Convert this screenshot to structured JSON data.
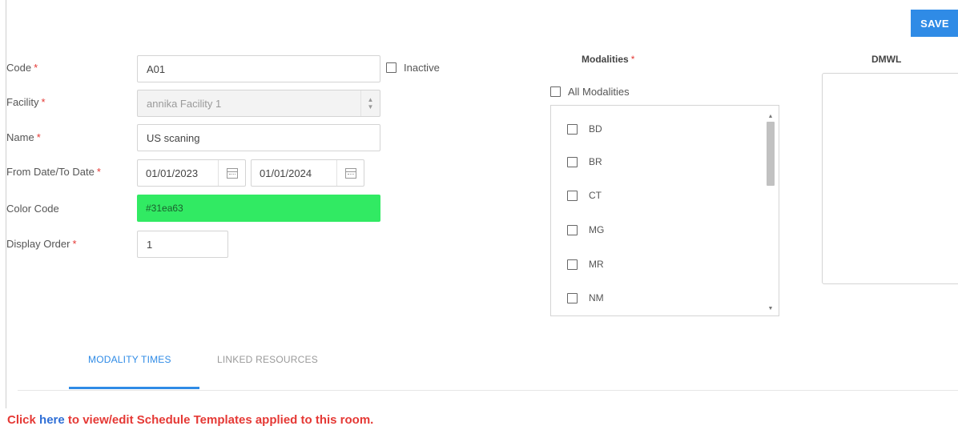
{
  "toolbar": {
    "save_label": "SAVE"
  },
  "form": {
    "code": {
      "label": "Code",
      "value": "A01"
    },
    "inactive_label": "Inactive",
    "facility": {
      "label": "Facility",
      "value": "annika Facility 1"
    },
    "name": {
      "label": "Name",
      "value": "US scaning"
    },
    "dates": {
      "label": "From Date/To Date",
      "from": "01/01/2023",
      "to": "01/01/2024"
    },
    "color_code": {
      "label": "Color Code",
      "value": "#31ea63"
    },
    "display_order": {
      "label": "Display Order",
      "value": "1"
    },
    "required_marker": "*"
  },
  "modalities": {
    "title": "Modalities",
    "all_label": "All Modalities",
    "items": [
      "BD",
      "BR",
      "CT",
      "MG",
      "MR",
      "NM"
    ]
  },
  "dmwl": {
    "title": "DMWL"
  },
  "tabs": [
    {
      "label": "MODALITY TIMES",
      "active": true
    },
    {
      "label": "LINKED RESOURCES",
      "active": false
    }
  ],
  "notice": {
    "prefix": "Click ",
    "link": "here",
    "suffix": " to view/edit Schedule Templates applied to this room."
  },
  "colors": {
    "accent": "#2f8be6",
    "required": "#e53935",
    "color_code_swatch": "#31ea63"
  }
}
